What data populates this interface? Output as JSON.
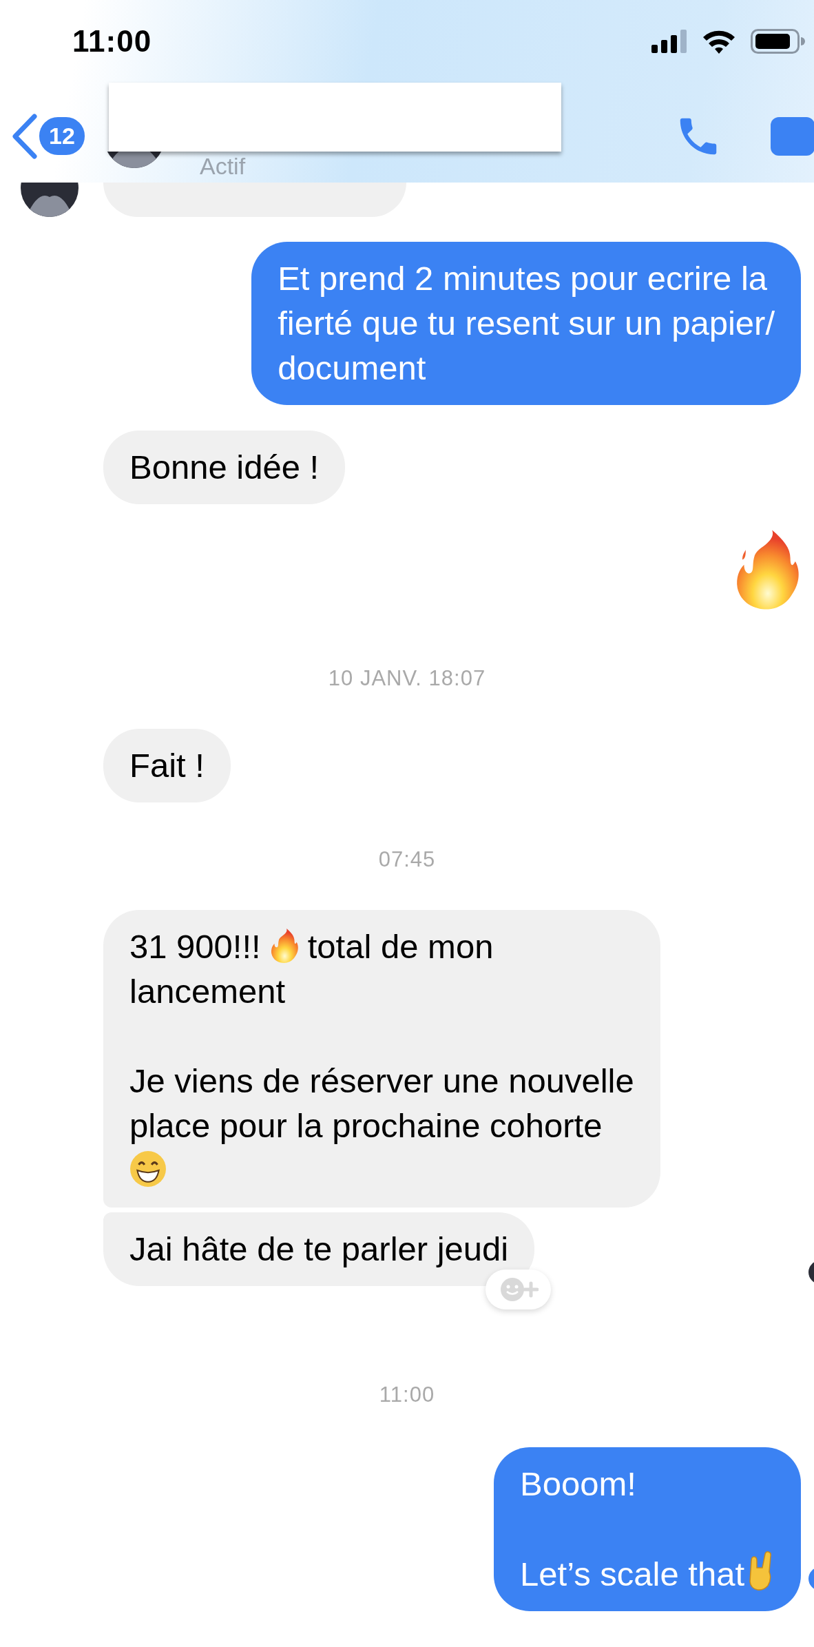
{
  "status_bar": {
    "time": "11:00"
  },
  "header": {
    "back_badge": "12",
    "subtitle": "Actif"
  },
  "messages": [
    {
      "kind": "partial"
    },
    {
      "kind": "bubble",
      "outgoing": true,
      "joined_above": false,
      "joined_below": false,
      "reaction": false,
      "seen": false,
      "paragraphs": [
        [
          [
            {
              "kind": "text",
              "text": "Et prend 2 minutes pour ecrire la"
            }
          ],
          [
            {
              "kind": "text",
              "text": "fierté que tu resent sur un papier/"
            }
          ],
          [
            {
              "kind": "text",
              "text": "document"
            }
          ]
        ]
      ]
    },
    {
      "kind": "bubble",
      "outgoing": false,
      "joined_above": false,
      "joined_below": false,
      "reaction": false,
      "seen": false,
      "paragraphs": [
        [
          [
            {
              "kind": "text",
              "text": "Bonne idée !"
            }
          ]
        ]
      ]
    },
    {
      "kind": "fire-emoji"
    },
    {
      "kind": "timestamp",
      "text": "10 JANV. 18:07"
    },
    {
      "kind": "bubble",
      "outgoing": false,
      "joined_above": false,
      "joined_below": false,
      "reaction": false,
      "seen": false,
      "paragraphs": [
        [
          [
            {
              "kind": "text",
              "text": "Fait !"
            }
          ]
        ]
      ]
    },
    {
      "kind": "timestamp",
      "text": "07:45"
    },
    {
      "kind": "bubble",
      "outgoing": false,
      "joined_above": false,
      "joined_below": true,
      "reaction": false,
      "seen": false,
      "paragraphs": [
        [
          [
            {
              "kind": "text",
              "text": "31 900!!!"
            },
            {
              "kind": "fire"
            },
            {
              "kind": "text",
              "text": "total de mon"
            }
          ],
          [
            {
              "kind": "text",
              "text": "lancement"
            }
          ]
        ],
        [
          [
            {
              "kind": "text",
              "text": "Je viens de réserver une nouvelle"
            }
          ],
          [
            {
              "kind": "text",
              "text": "place pour la prochaine cohorte"
            }
          ],
          [
            {
              "kind": "grin"
            }
          ]
        ]
      ]
    },
    {
      "kind": "bubble",
      "outgoing": false,
      "joined_above": true,
      "joined_below": false,
      "reaction": true,
      "seen": true,
      "paragraphs": [
        [
          [
            {
              "kind": "text",
              "text": "Jai hâte de te parler jeudi"
            }
          ]
        ]
      ]
    },
    {
      "kind": "timestamp",
      "text": "11:00"
    },
    {
      "kind": "bubble",
      "outgoing": true,
      "joined_above": false,
      "joined_below": false,
      "reaction": false,
      "seen": true,
      "paragraphs": [
        [
          [
            {
              "kind": "text",
              "text": "Booom!"
            }
          ]
        ],
        [
          [
            {
              "kind": "text",
              "text": "Let’s scale that"
            },
            {
              "kind": "rock"
            }
          ]
        ]
      ]
    }
  ]
}
